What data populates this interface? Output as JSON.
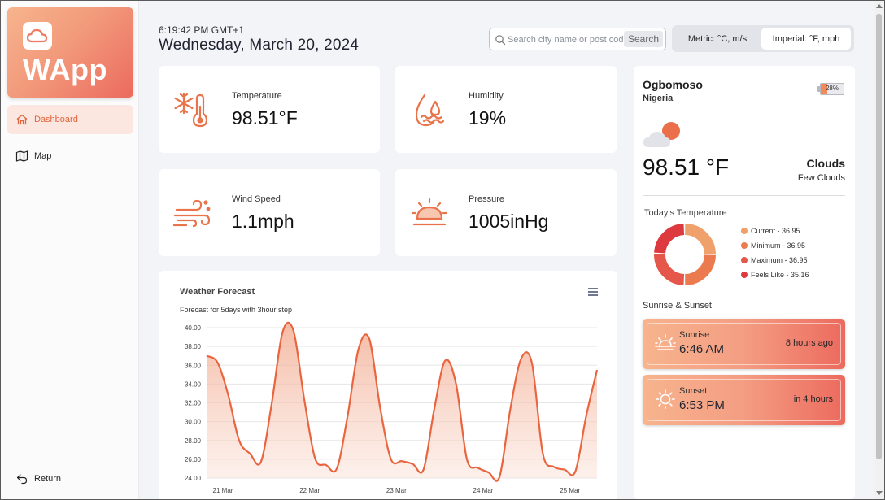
{
  "app": {
    "name": "WApp",
    "logo_icon": "cloud-icon"
  },
  "sidebar": {
    "items": [
      {
        "label": "Dashboard",
        "icon": "home-icon",
        "active": true
      },
      {
        "label": "Map",
        "icon": "map-icon",
        "active": false
      }
    ],
    "return_label": "Return",
    "return_icon": "return-arrow-icon"
  },
  "header": {
    "time": "6:19:42 PM GMT+1",
    "date": "Wednesday, March 20, 2024"
  },
  "search": {
    "placeholder": "Search city name or post code",
    "button_label": "Search",
    "icon": "search-icon"
  },
  "units": {
    "metric_label": "Metric: °C, m/s",
    "imperial_label": "Imperial: °F, mph",
    "selected": "imperial"
  },
  "stats": {
    "temperature": {
      "label": "Temperature",
      "value": "98.51°F",
      "icon": "thermometer-snowflake-icon"
    },
    "humidity": {
      "label": "Humidity",
      "value": "19%",
      "icon": "humidity-drops-icon"
    },
    "wind": {
      "label": "Wind Speed",
      "value": "1.1mph",
      "icon": "wind-icon"
    },
    "pressure": {
      "label": "Pressure",
      "value": "1005inHg",
      "icon": "sunrise-pressure-icon"
    }
  },
  "forecast": {
    "title": "Weather Forecast",
    "subtitle": "Forecast for 5days with 3hour step",
    "menu_icon": "hamburger-menu-icon"
  },
  "chart_data": {
    "type": "area",
    "title": "Weather Forecast",
    "subtitle": "Forecast for 5days with 3hour step",
    "xlabel": "",
    "ylabel": "",
    "ylim": [
      24,
      40
    ],
    "yticks": [
      "24.00",
      "26.00",
      "28.00",
      "30.00",
      "32.00",
      "34.00",
      "36.00",
      "38.00",
      "40.00"
    ],
    "x_tick_labels": [
      "21 Mar",
      "22 Mar",
      "23 Mar",
      "24 Mar",
      "25 Mar"
    ],
    "x_tick_positions": [
      1.5,
      9.5,
      17.5,
      25.5,
      33.5
    ],
    "series": [
      {
        "color": "#e9653f",
        "values": [
          37.0,
          36.3,
          32.8,
          28.0,
          26.6,
          25.7,
          31.9,
          39.5,
          39.7,
          32.4,
          26.1,
          25.4,
          25.0,
          30.6,
          37.7,
          38.8,
          31.5,
          26.0,
          25.8,
          25.5,
          24.9,
          31.4,
          36.5,
          34.0,
          26.0,
          25.1,
          24.6,
          24.1,
          31.3,
          36.7,
          36.2,
          26.6,
          25.2,
          24.9,
          24.7,
          30.6,
          35.5
        ]
      }
    ],
    "grid": true
  },
  "location": {
    "city": "Ogbomoso",
    "country": "Nigeria",
    "battery": "28%",
    "battery_level": 0.28,
    "weather_icon": "cloud-sun-icon",
    "temperature": "98.51 °F",
    "condition": "Clouds",
    "condition_desc": "Few Clouds"
  },
  "today_temp": {
    "title": "Today's Temperature",
    "legend": [
      {
        "label": "Current - 36.95",
        "value": 36.95,
        "color": "#f0a06a"
      },
      {
        "label": "Minimum - 36.95",
        "value": 36.95,
        "color": "#ec7a4f"
      },
      {
        "label": "Maximum - 36.95",
        "value": 36.95,
        "color": "#e4574a"
      },
      {
        "label": "Feels Like - 35.16",
        "value": 35.16,
        "color": "#dc3a3f"
      }
    ]
  },
  "sun": {
    "title": "Sunrise & Sunset",
    "sunrise": {
      "label": "Sunrise",
      "time": "6:46 AM",
      "relative": "8 hours ago",
      "icon": "sunrise-icon"
    },
    "sunset": {
      "label": "Sunset",
      "time": "6:53 PM",
      "relative": "in 4 hours",
      "icon": "sun-icon"
    }
  }
}
